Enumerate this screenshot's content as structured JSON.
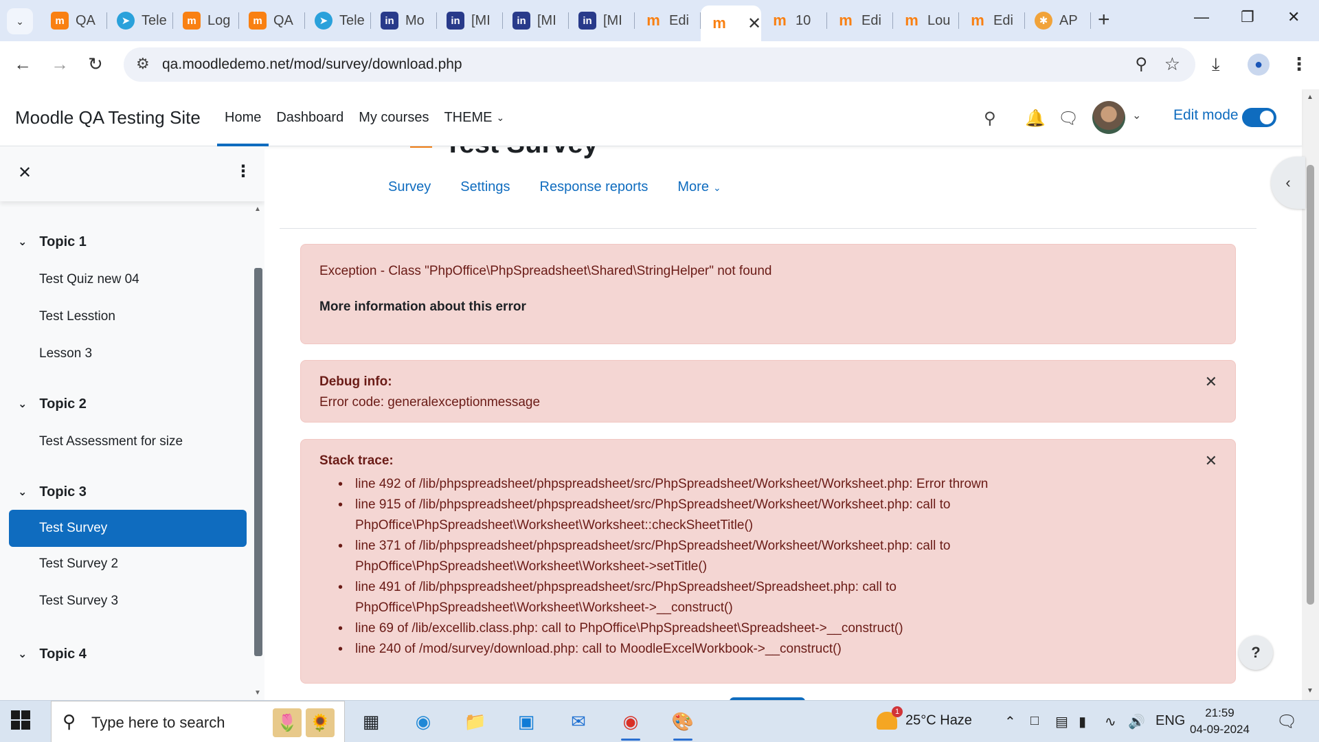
{
  "browser": {
    "tabs": [
      {
        "label": "QA",
        "fav": "moodle"
      },
      {
        "label": "Tele",
        "fav": "telegram"
      },
      {
        "label": "Log",
        "fav": "moodle"
      },
      {
        "label": "QA",
        "fav": "moodle"
      },
      {
        "label": "Tele",
        "fav": "telegram"
      },
      {
        "label": "Mo",
        "fav": "in"
      },
      {
        "label": "[MI",
        "fav": "in"
      },
      {
        "label": "[MI",
        "fav": "in"
      },
      {
        "label": "[MI",
        "fav": "in"
      },
      {
        "label": "Edi",
        "fav": "moodle-cap"
      },
      {
        "label": "",
        "fav": "moodle-cap"
      },
      {
        "label": "10",
        "fav": "moodle-cap"
      },
      {
        "label": "Edi",
        "fav": "moodle-cap"
      },
      {
        "label": "Lou",
        "fav": "moodle-cap"
      },
      {
        "label": "Edi",
        "fav": "moodle-cap"
      },
      {
        "label": "AP",
        "fav": "api"
      }
    ],
    "url": "qa.moodledemo.net/mod/survey/download.php"
  },
  "navbar": {
    "site_name": "Moodle QA Testing Site",
    "items": [
      "Home",
      "Dashboard",
      "My courses",
      "THEME"
    ],
    "edit_mode": "Edit mode"
  },
  "course_index": {
    "topics": [
      {
        "name": "Topic 1",
        "items": [
          "Test Quiz new 04",
          "Test Lesstion",
          "Lesson 3"
        ]
      },
      {
        "name": "Topic 2",
        "items": [
          "Test Assessment for size"
        ]
      },
      {
        "name": "Topic 3",
        "items": [
          "Test Survey",
          "Test Survey 2",
          "Test Survey 3"
        ]
      },
      {
        "name": "Topic 4",
        "items": []
      }
    ],
    "active_item": "Test Survey"
  },
  "page": {
    "title": "Test Survey",
    "secondary_nav": [
      "Survey",
      "Settings",
      "Response reports",
      "More"
    ]
  },
  "error": {
    "message": "Exception - Class \"PhpOffice\\PhpSpreadsheet\\Shared\\StringHelper\" not found",
    "more_info": "More information about this error",
    "debug_heading": "Debug info:",
    "debug_text": "Error code: generalexceptionmessage",
    "stack_heading": "Stack trace:",
    "stack": [
      {
        "l1": "line 492 of /lib/phpspreadsheet/phpspreadsheet/src/PhpSpreadsheet/Worksheet/Worksheet.php: Error thrown",
        "l2": ""
      },
      {
        "l1": "line 915 of /lib/phpspreadsheet/phpspreadsheet/src/PhpSpreadsheet/Worksheet/Worksheet.php: call to",
        "l2": "PhpOffice\\PhpSpreadsheet\\Worksheet\\Worksheet::checkSheetTitle()"
      },
      {
        "l1": "line 371 of /lib/phpspreadsheet/phpspreadsheet/src/PhpSpreadsheet/Worksheet/Worksheet.php: call to",
        "l2": "PhpOffice\\PhpSpreadsheet\\Worksheet\\Worksheet->setTitle()"
      },
      {
        "l1": "line 491 of /lib/phpspreadsheet/phpspreadsheet/src/PhpSpreadsheet/Spreadsheet.php: call to",
        "l2": "PhpOffice\\PhpSpreadsheet\\Worksheet\\Worksheet->__construct()"
      },
      {
        "l1": "line 69 of /lib/excellib.class.php: call to PhpOffice\\PhpSpreadsheet\\Spreadsheet->__construct()",
        "l2": ""
      },
      {
        "l1": "line 240 of /mod/survey/download.php: call to MoodleExcelWorkbook->__construct()",
        "l2": ""
      }
    ]
  },
  "help": "?",
  "taskbar": {
    "search_placeholder": "Type here to search",
    "weather": "25°C  Haze",
    "weather_badge": "1",
    "language": "ENG",
    "time": "21:59",
    "date": "04-09-2024"
  },
  "colors": {
    "accent": "#0f6cbf",
    "alert_bg": "#f4d6d3",
    "alert_text": "#6a1b16"
  }
}
